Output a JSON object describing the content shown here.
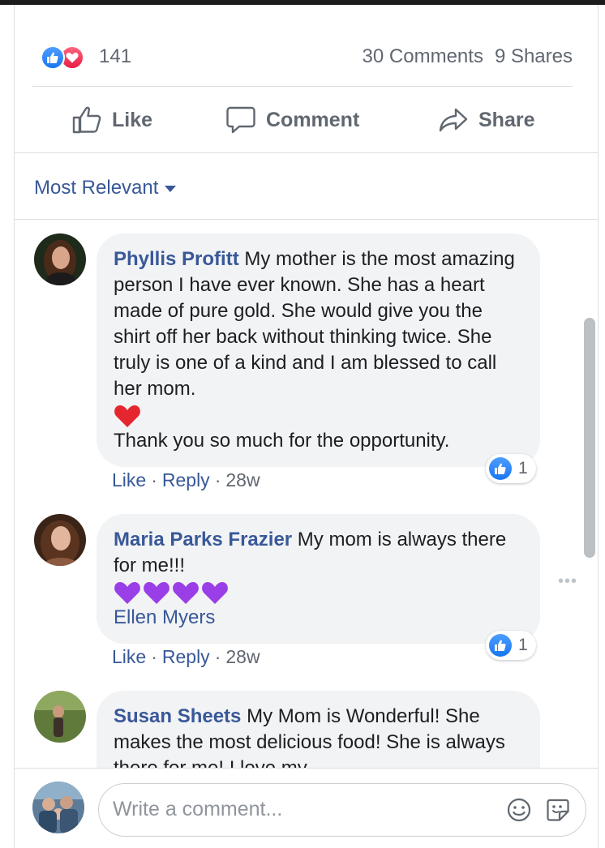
{
  "stats": {
    "reaction_count": "141",
    "comments": "30 Comments",
    "shares": "9 Shares"
  },
  "actions": {
    "like": "Like",
    "comment": "Comment",
    "share": "Share"
  },
  "sort": {
    "label": "Most Relevant"
  },
  "comments": [
    {
      "author": "Phyllis Profitt",
      "text": "My mother is the most amazing person I have ever known. She has a heart made of pure gold. She would give you the shirt off her back without thinking twice. She truly is one of a kind and I am blessed to call her mom.",
      "text2": "Thank you so much for the opportunity.",
      "emoji": "red-heart",
      "likes": "1",
      "like_label": "Like",
      "reply_label": "Reply",
      "time": "28w"
    },
    {
      "author": "Maria Parks Frazier",
      "text": "My mom is always there for me!!!",
      "emoji": "purple-heart x4",
      "mention": "Ellen Myers",
      "likes": "1",
      "like_label": "Like",
      "reply_label": "Reply",
      "time": "28w"
    },
    {
      "author": "Susan Sheets",
      "text": "My Mom is Wonderful! She makes the most delicious food! She is always there for me! I love my"
    }
  ],
  "composer": {
    "placeholder": "Write a comment..."
  },
  "colors": {
    "link_blue": "#385898",
    "like_blue": "#1877f2",
    "love_red": "#e61e43",
    "muted_gray": "#606770",
    "bubble_bg": "#f2f3f5"
  }
}
